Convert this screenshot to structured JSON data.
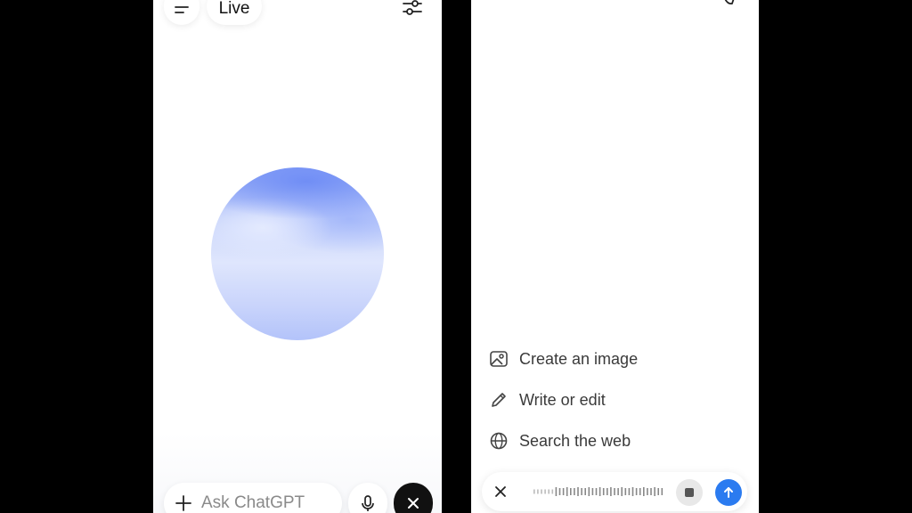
{
  "left_screen": {
    "mode_label": "Live",
    "input_placeholder": "Ask ChatGPT",
    "icons": {
      "menu": "menu-icon",
      "settings": "sliders-icon",
      "plus": "plus-icon",
      "mic": "mic-icon",
      "close": "close-icon"
    }
  },
  "right_screen": {
    "suggestions": [
      {
        "label": "Create an image",
        "icon": "image-icon"
      },
      {
        "label": "Write or edit",
        "icon": "pencil-icon"
      },
      {
        "label": "Search the web",
        "icon": "globe-icon"
      }
    ],
    "icons": {
      "close": "close-icon",
      "stop": "stop-icon",
      "send": "arrow-up-icon"
    }
  },
  "colors": {
    "orb_blue": "#8aa3f7",
    "send_button": "#2b7bf0",
    "close_button_dark": "#111111"
  }
}
